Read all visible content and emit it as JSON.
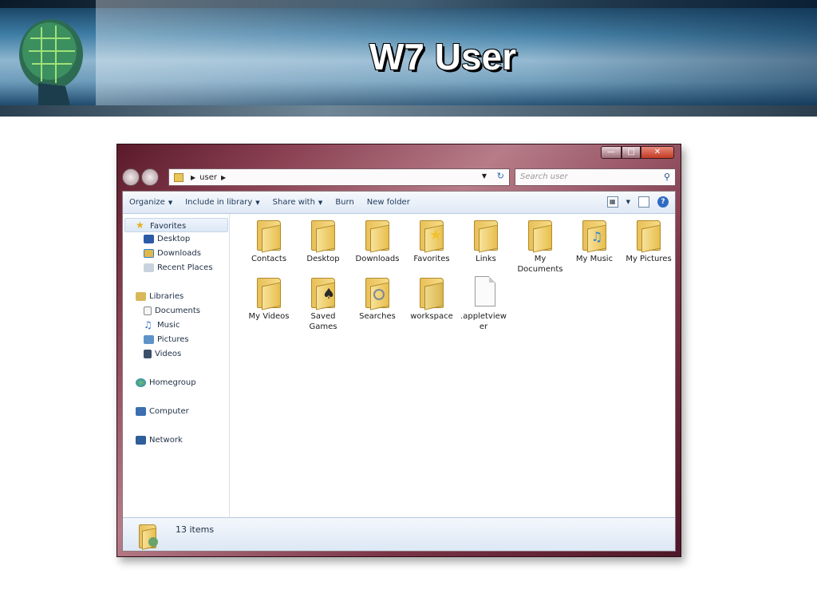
{
  "slide": {
    "title": "W7 User"
  },
  "window": {
    "address": {
      "crumb": "user",
      "search_placeholder": "Search user"
    },
    "toolbar": {
      "organize": "Organize",
      "include_in_library": "Include in library",
      "share_with": "Share with",
      "burn": "Burn",
      "new_folder": "New folder"
    },
    "nav_pane": {
      "favorites": "Favorites",
      "desktop": "Desktop",
      "downloads": "Downloads",
      "recent_places": "Recent Places",
      "libraries": "Libraries",
      "documents": "Documents",
      "music": "Music",
      "pictures": "Pictures",
      "videos": "Videos",
      "homegroup": "Homegroup",
      "computer": "Computer",
      "network": "Network"
    },
    "files": [
      {
        "label": "Contacts",
        "icon": "contacts-folder-icon",
        "badge_color": "#6a9bd8"
      },
      {
        "label": "Desktop",
        "icon": "desktop-folder-icon",
        "badge_color": "#2f5fb3"
      },
      {
        "label": "Downloads",
        "icon": "downloads-folder-icon",
        "badge_color": "#2c7fd6"
      },
      {
        "label": "Favorites",
        "icon": "favorites-folder-icon",
        "badge_color": "#f0c22e"
      },
      {
        "label": "Links",
        "icon": "links-folder-icon",
        "badge_color": "#2a79c2"
      },
      {
        "label": "My Documents",
        "icon": "documents-folder-icon",
        "badge_color": "#e7eef7"
      },
      {
        "label": "My Music",
        "icon": "music-folder-icon",
        "badge_color": "#2f82d6"
      },
      {
        "label": "My Pictures",
        "icon": "pictures-folder-icon",
        "badge_color": "#4a8ec4"
      },
      {
        "label": "My Videos",
        "icon": "videos-folder-icon",
        "badge_color": "#3b5e8a"
      },
      {
        "label": "Saved Games",
        "icon": "saved-games-folder-icon",
        "badge_color": "#2a2a2a"
      },
      {
        "label": "Searches",
        "icon": "searches-folder-icon",
        "badge_color": "#cfd8e4"
      },
      {
        "label": "workspace",
        "icon": "workspace-folder-icon",
        "badge_color": "#e2c97a"
      },
      {
        "label": ".appletviewer",
        "icon": "file-icon",
        "badge_color": ""
      }
    ],
    "status": {
      "count": "13 items"
    }
  }
}
